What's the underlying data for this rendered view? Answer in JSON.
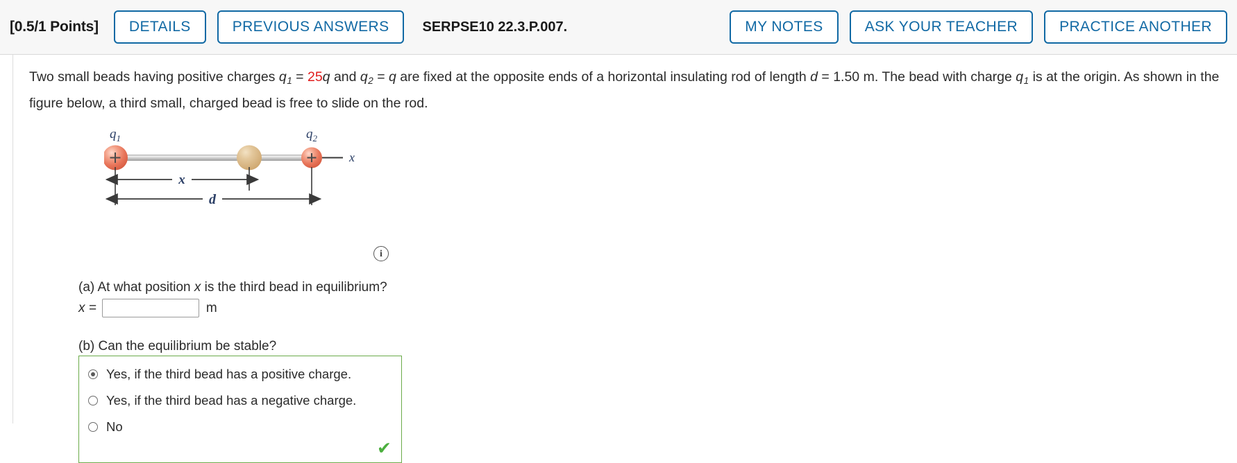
{
  "header": {
    "points": "[0.5/1 Points]",
    "details_label": "DETAILS",
    "previous_answers_label": "PREVIOUS ANSWERS",
    "exercise_id": "SERPSE10 22.3.P.007.",
    "my_notes_label": "MY NOTES",
    "ask_teacher_label": "ASK YOUR TEACHER",
    "practice_another_label": "PRACTICE ANOTHER",
    "accent_color": "#1169a4"
  },
  "prompt": {
    "seg1": "Two small beads having positive charges ",
    "q1": "q",
    "q1_sub": "1",
    "eq1": " = ",
    "charge1_value": "25",
    "charge1_unit": "q",
    "seg2": " and ",
    "q2": "q",
    "q2_sub": "2",
    "eq2": " = ",
    "charge2_value": "q",
    "seg3": " are fixed at the opposite ends of a horizontal insulating rod of length ",
    "d_sym": "d",
    "eq3": " = ",
    "d_value": "1.50 m.",
    "seg4": " The bead with charge ",
    "q3": "q",
    "q3_sub": "1",
    "seg5": " is at the origin. As shown in the figure below, a third small, charged bead is free to slide on the rod."
  },
  "figure": {
    "label_q1": "q",
    "label_q1_sub": "1",
    "label_q2": "q",
    "label_q2_sub": "2",
    "label_axis_x": "x",
    "label_dim_x": "x",
    "label_dim_d": "d",
    "plus_sign": "+",
    "bead_charged_color": "#e8735a",
    "bead_neutral_color": "#d9b37c",
    "rod_color": "#c9c9c9",
    "info_icon_glyph": "i"
  },
  "part_a": {
    "question": "(a) At what position x is the third bead in equilibrium?",
    "question_prefix": "(a) At what position ",
    "question_var": "x",
    "question_suffix": " is the third bead in equilibrium?",
    "answer_label": "x =",
    "answer_value": "",
    "answer_placeholder": "",
    "unit": "m"
  },
  "part_b": {
    "question": "(b) Can the equilibrium be stable?",
    "options": [
      {
        "label": "Yes, if the third bead has a positive charge.",
        "selected": true
      },
      {
        "label": "Yes, if the third bead has a negative charge.",
        "selected": false
      },
      {
        "label": "No",
        "selected": false
      }
    ],
    "status_glyph": "✔",
    "status_color": "#4caf3f",
    "box_border_color": "#6bab4a"
  }
}
